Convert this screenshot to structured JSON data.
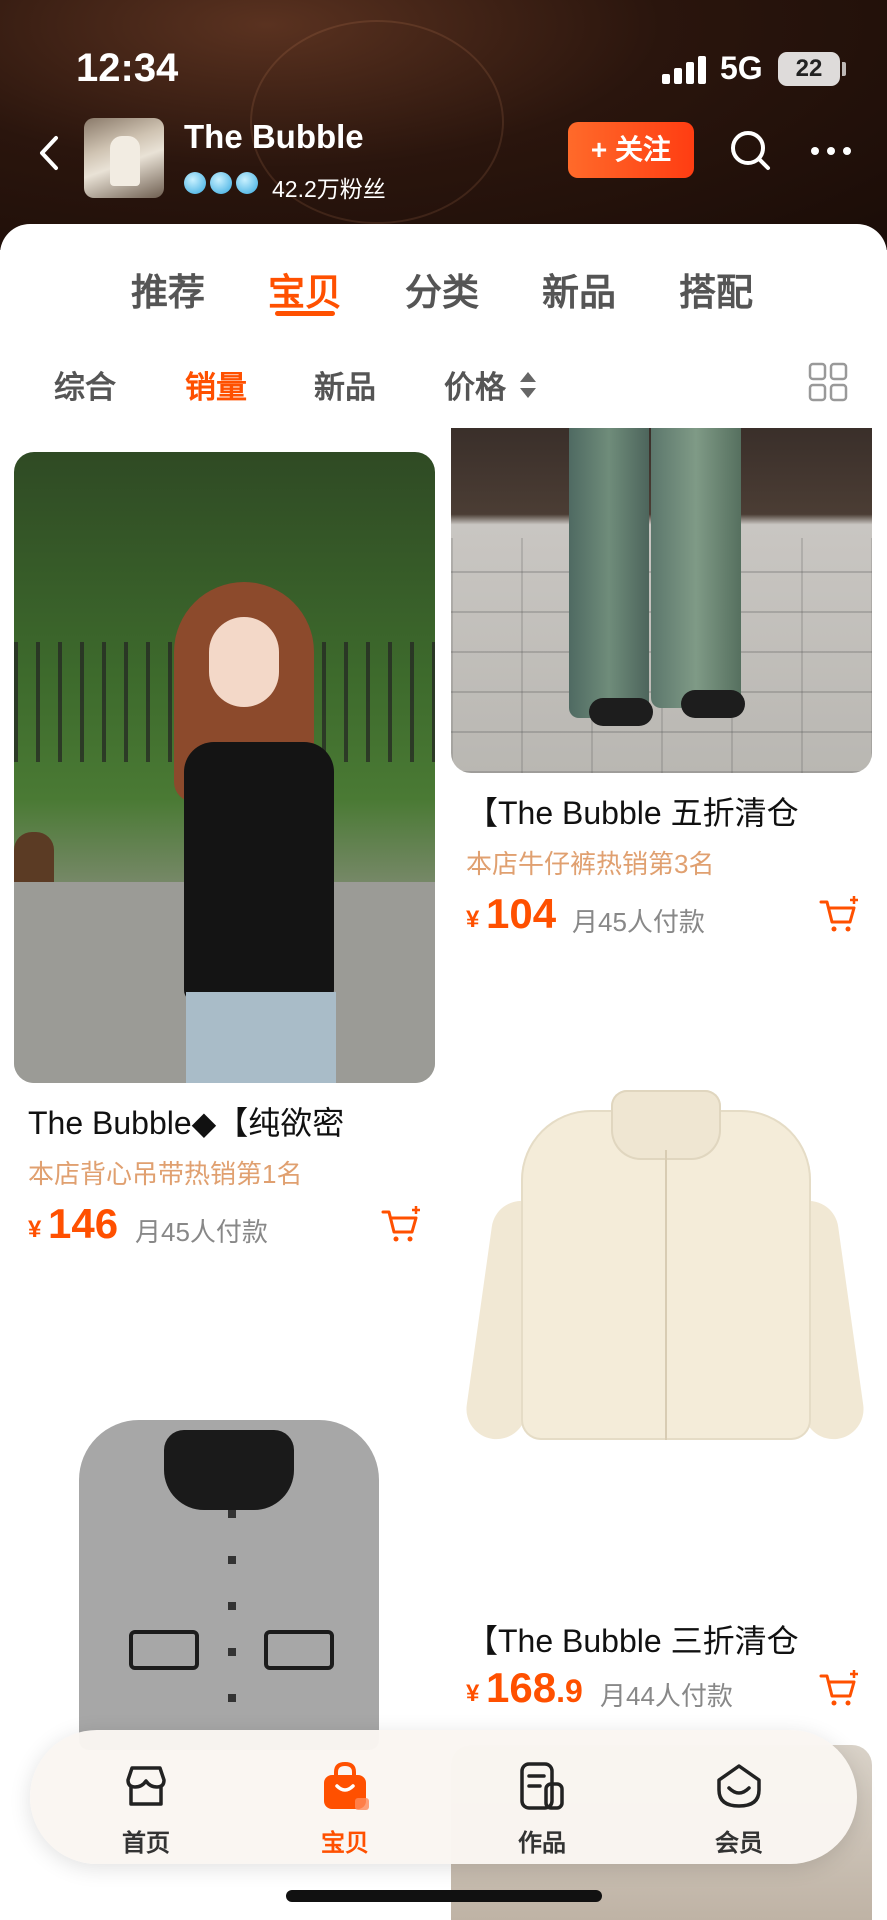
{
  "status_bar": {
    "time": "12:34",
    "network": "5G",
    "battery": "22"
  },
  "shop": {
    "name": "The Bubble",
    "fans": "42.2万粉丝",
    "follow_label": "+ 关注"
  },
  "tabs": [
    {
      "label": "推荐"
    },
    {
      "label": "宝贝"
    },
    {
      "label": "分类"
    },
    {
      "label": "新品"
    },
    {
      "label": "搭配"
    }
  ],
  "active_tab": "宝贝",
  "sort_options": [
    {
      "label": "综合"
    },
    {
      "label": "销量"
    },
    {
      "label": "新品"
    },
    {
      "label": "价格"
    }
  ],
  "active_sort": "销量",
  "products": [
    {
      "title": "The Bubble◆【纯欲密",
      "tag": "本店背心吊带热销第1名",
      "currency": "¥",
      "price": "146",
      "price_decimal": "",
      "sold": "月45人付款"
    },
    {
      "title": "【The Bubble 五折清仓",
      "tag": "本店牛仔裤热销第3名",
      "currency": "¥",
      "price": "104",
      "price_decimal": "",
      "sold": "月45人付款"
    },
    {
      "title": "【The Bubble 三折清仓",
      "tag": "",
      "currency": "¥",
      "price": "168",
      "price_decimal": ".9",
      "sold": "月44人付款"
    }
  ],
  "bottom_nav": [
    {
      "label": "首页",
      "icon": "shop-icon"
    },
    {
      "label": "宝贝",
      "icon": "bag-icon"
    },
    {
      "label": "作品",
      "icon": "works-icon"
    },
    {
      "label": "会员",
      "icon": "member-icon"
    }
  ],
  "colors": {
    "accent": "#ff5000",
    "header_bg": "#2a150d",
    "tag": "#e0a070"
  }
}
